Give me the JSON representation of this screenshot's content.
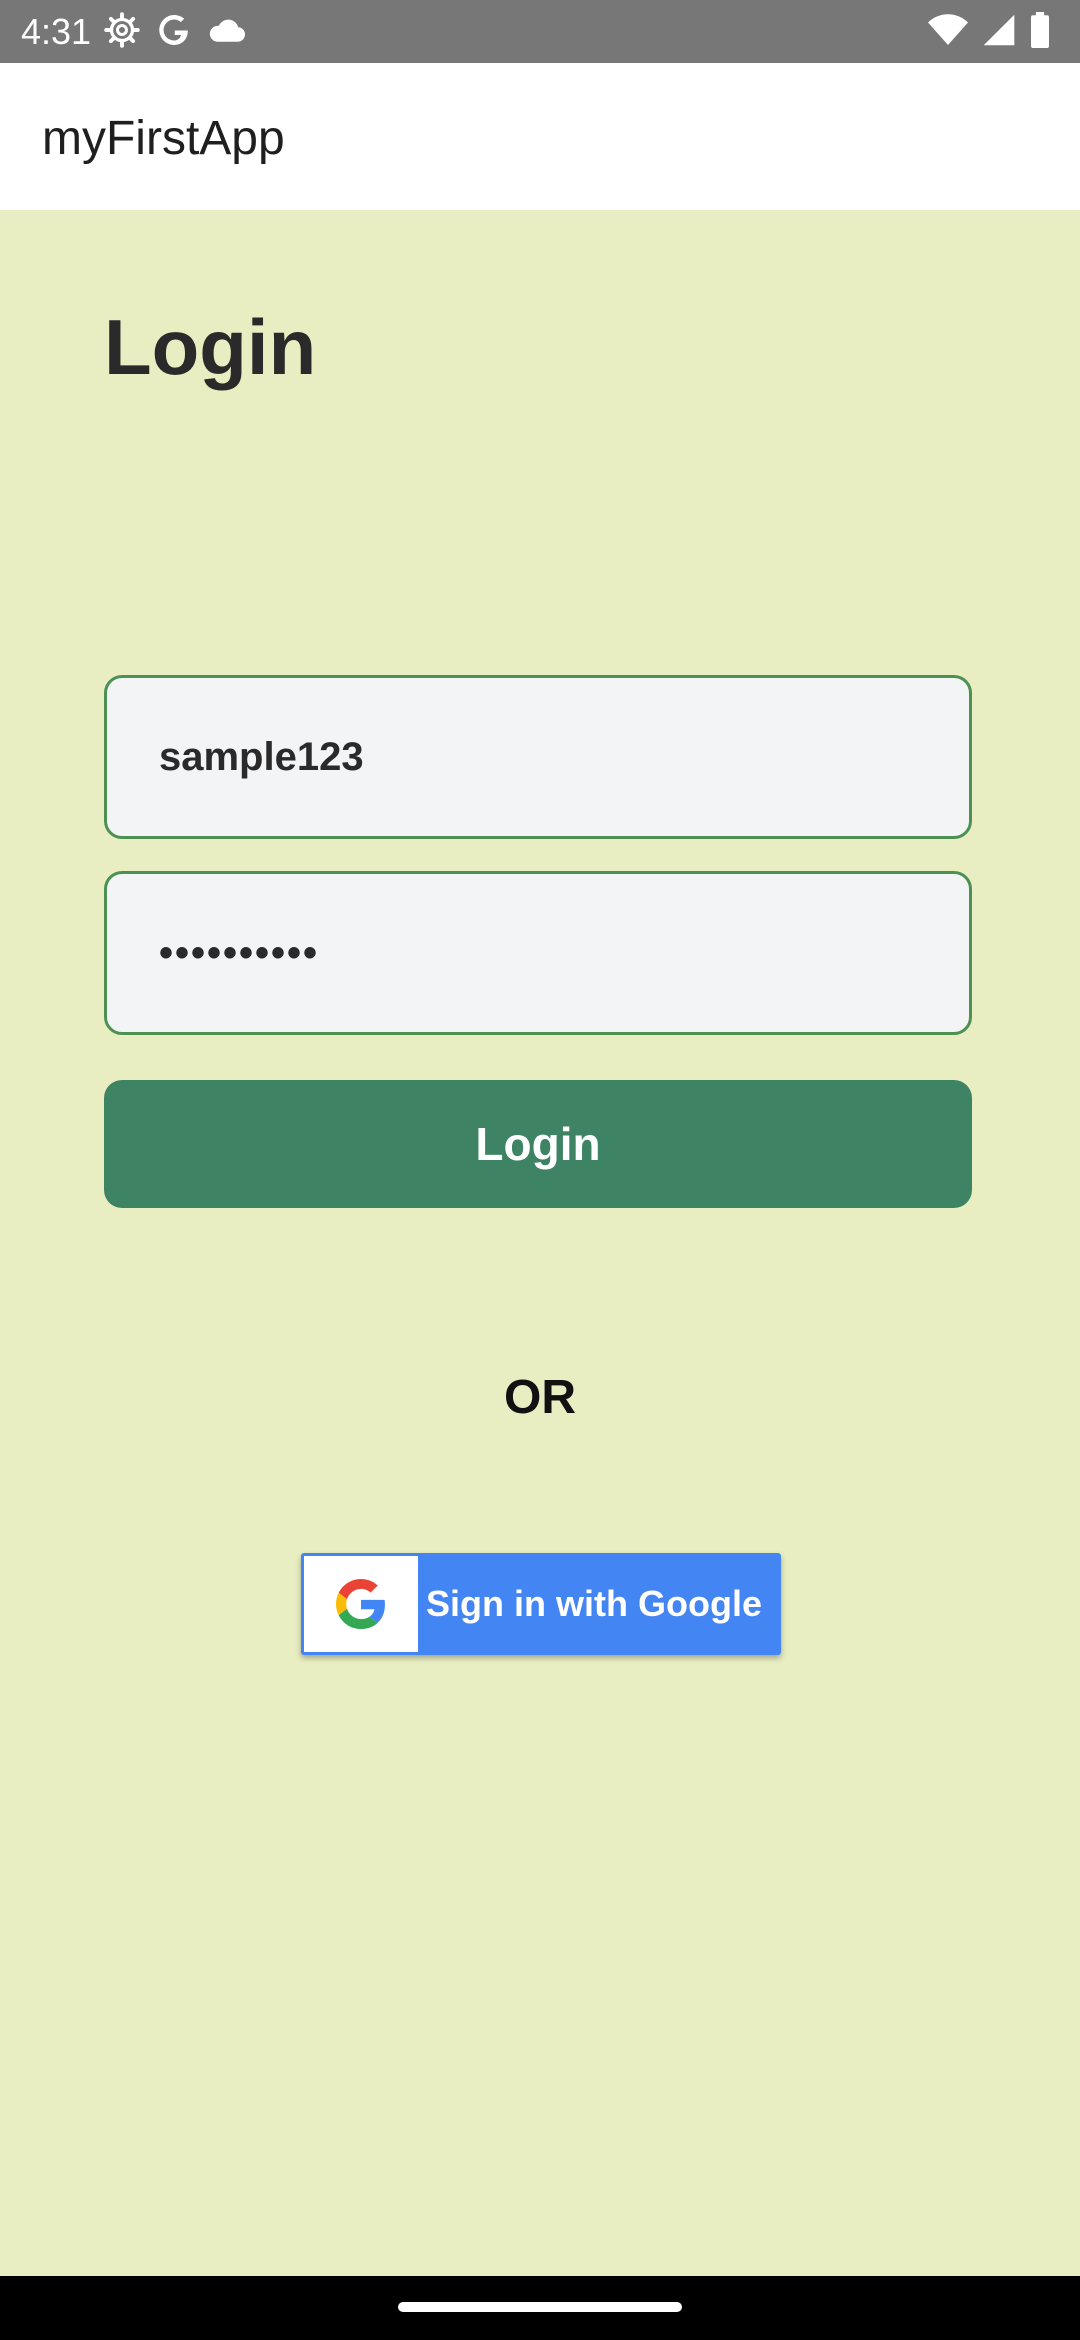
{
  "status_bar": {
    "time": "4:31",
    "left_icons": [
      "settings-icon",
      "google-icon",
      "cloud-icon"
    ],
    "right_icons": [
      "wifi-icon",
      "signal-icon",
      "battery-icon"
    ],
    "background": "#777777"
  },
  "app_bar": {
    "title": "myFirstApp"
  },
  "login": {
    "title": "Login",
    "username_value": "sample123",
    "password_value": "••••••••••",
    "button_label": "Login",
    "button_color": "#3e8363",
    "field_border_color": "#4d9152",
    "background": "#e8edc2"
  },
  "divider": {
    "text": "OR"
  },
  "google_signin": {
    "label": "Sign in with Google",
    "icon": "google-g-icon",
    "color": "#4485f4"
  }
}
